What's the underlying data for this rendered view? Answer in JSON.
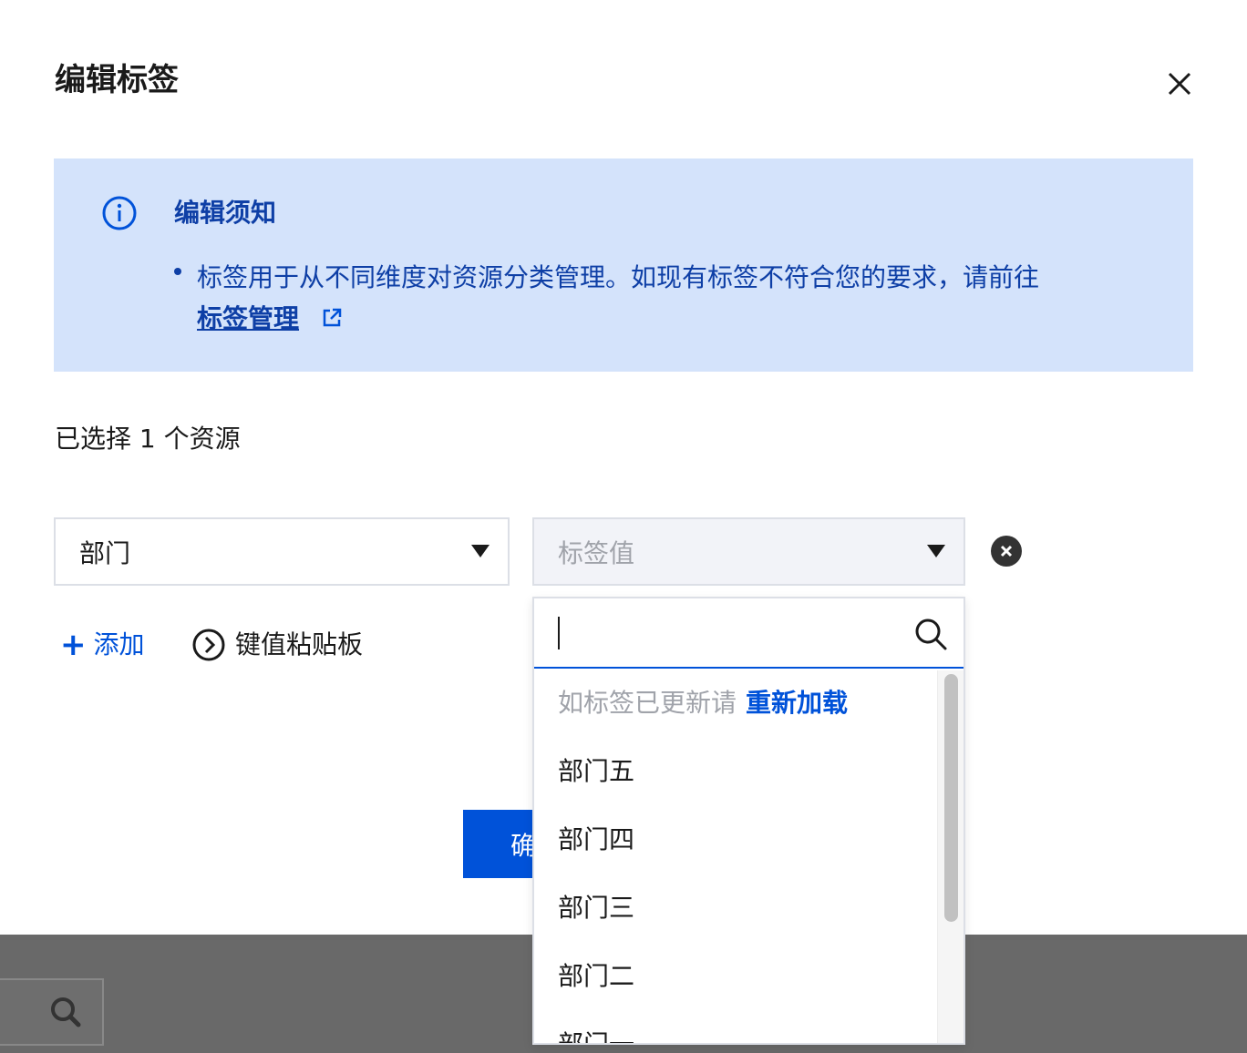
{
  "dialog": {
    "title": "编辑标签",
    "close_icon": "close-icon"
  },
  "notice": {
    "icon": "info-icon",
    "title": "编辑须知",
    "text": "标签用于从不同维度对资源分类管理。如现有标签不符合您的要求，请前往",
    "link_label": "标签管理",
    "link_icon": "external-link-icon"
  },
  "selection": {
    "count_text": "已选择 1 个资源"
  },
  "tag_row": {
    "key_value": "部门",
    "value_placeholder": "标签值"
  },
  "actions": {
    "add_label": "添加",
    "paste_label": "键值粘贴板",
    "confirm_label": "确"
  },
  "dropdown": {
    "search_value": "",
    "reload_hint": "如标签已更新请",
    "reload_link": "重新加载",
    "options": [
      "部门五",
      "部门四",
      "部门三",
      "部门二",
      "部门一"
    ]
  },
  "colors": {
    "primary": "#0052d9",
    "notice_bg": "#d4e3fb",
    "notice_text": "#0e3fa6",
    "overlay": "#696969"
  }
}
